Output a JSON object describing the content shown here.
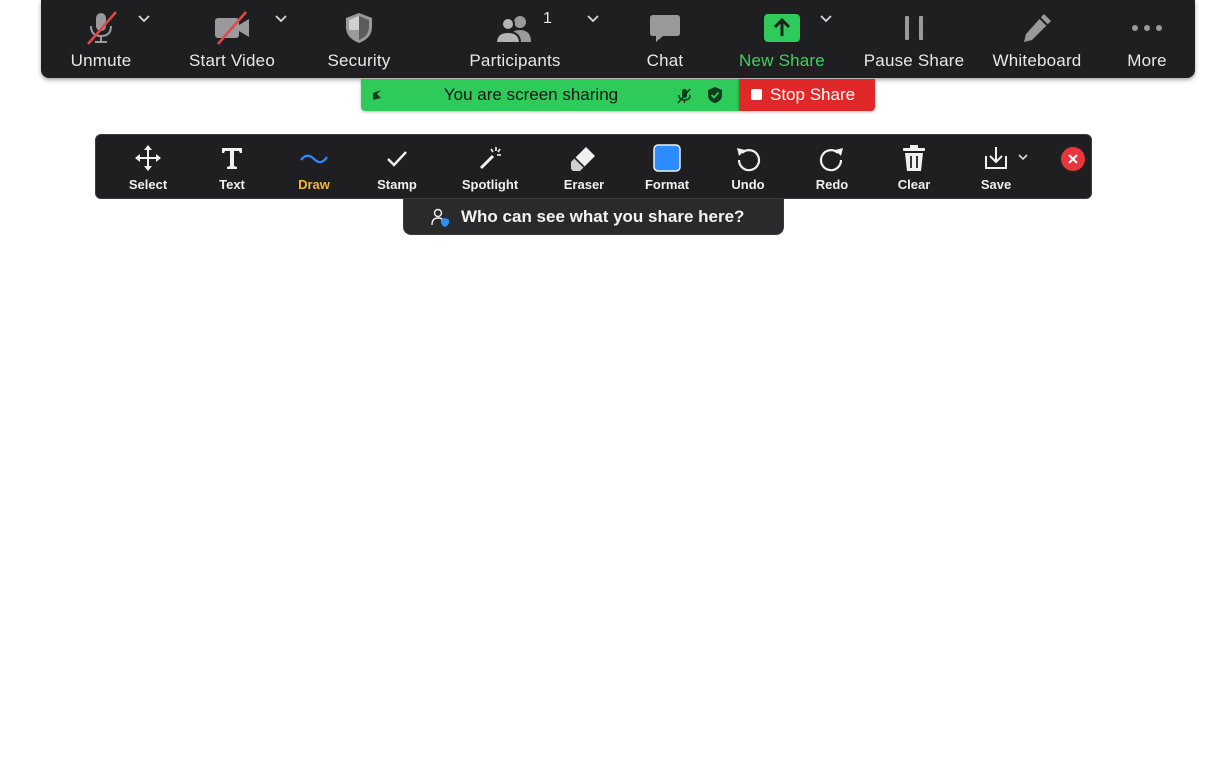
{
  "meeting_toolbar": {
    "buttons": [
      {
        "label": "Unmute",
        "icon": "microphone-muted-icon"
      },
      {
        "label": "Start Video",
        "icon": "video-off-icon"
      },
      {
        "label": "Security",
        "icon": "shield-icon"
      },
      {
        "label": "Participants",
        "icon": "participants-icon"
      },
      {
        "label": "Chat",
        "icon": "chat-bubble-icon"
      },
      {
        "label": "New Share",
        "icon": "share-up-arrow-icon"
      },
      {
        "label": "Pause Share",
        "icon": "pause-icon"
      },
      {
        "label": "Whiteboard",
        "icon": "pencil-icon"
      },
      {
        "label": "More",
        "icon": "more-dots-icon"
      }
    ],
    "participant_count": "1"
  },
  "share_banner": {
    "text": "You are screen sharing",
    "stop_label": "Stop Share"
  },
  "annotation_toolbar": {
    "tools": [
      {
        "label": "Select",
        "icon": "move-arrows-icon"
      },
      {
        "label": "Text",
        "icon": "text-t-icon"
      },
      {
        "label": "Draw",
        "icon": "squiggle-line-icon"
      },
      {
        "label": "Stamp",
        "icon": "checkmark-icon"
      },
      {
        "label": "Spotlight",
        "icon": "magic-wand-icon"
      },
      {
        "label": "Eraser",
        "icon": "eraser-icon"
      },
      {
        "label": "Format",
        "icon": "color-square-icon"
      },
      {
        "label": "Undo",
        "icon": "undo-icon"
      },
      {
        "label": "Redo",
        "icon": "redo-icon"
      },
      {
        "label": "Clear",
        "icon": "trash-icon"
      },
      {
        "label": "Save",
        "icon": "download-icon"
      }
    ],
    "active_tool": "Draw",
    "who_can_see": "Who can see what you share here?"
  },
  "colors": {
    "toolbar_bg": "#1f1f21",
    "share_green": "#2fcb5a",
    "stop_red": "#e02828",
    "active_tool": "#f4b63d",
    "format_blue": "#2d8cff",
    "new_share_green": "#3fd05f"
  }
}
